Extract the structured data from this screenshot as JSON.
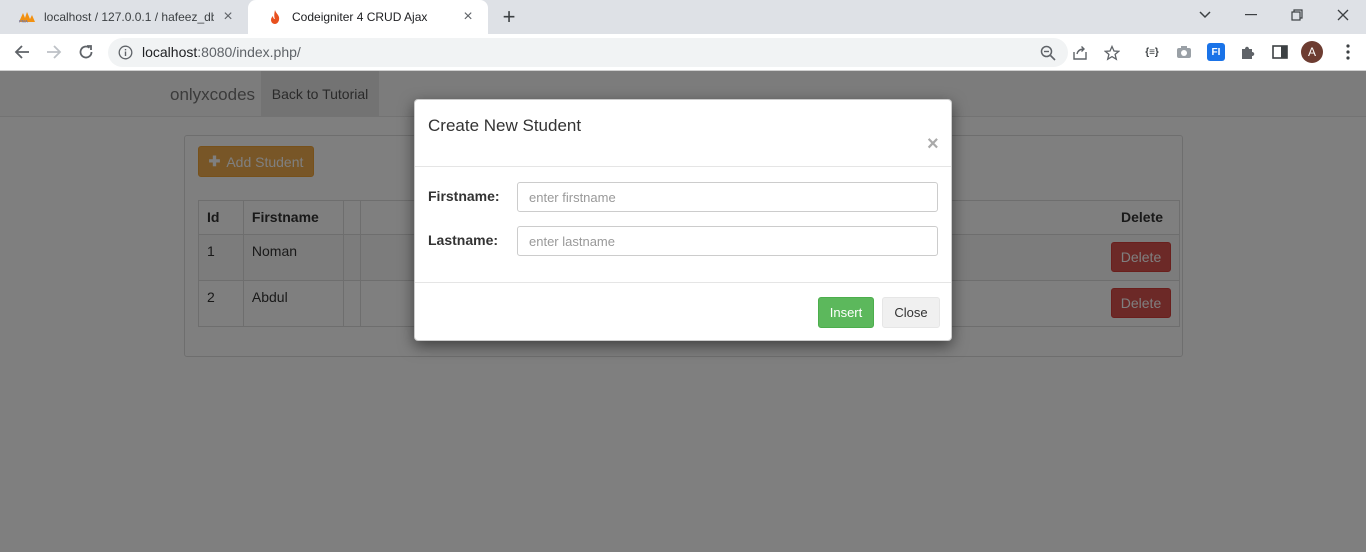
{
  "browser": {
    "tabs": [
      {
        "title": "localhost / 127.0.0.1 / hafeez_db / ",
        "active": false,
        "favicon": "phpmyadmin-icon"
      },
      {
        "title": "Codeigniter 4 CRUD Ajax",
        "active": true,
        "favicon": "codeigniter-flame-icon"
      }
    ],
    "url_host": "localhost",
    "url_rest": ":8080/index.php/",
    "profile_initial": "A",
    "extension_label": "{≡}",
    "extension_fi": "FI"
  },
  "page": {
    "brand": "onlyxcodes",
    "nav_link": "Back to Tutorial",
    "add_button": "Add Student",
    "table": {
      "headers": [
        "Id",
        "Firstname",
        "Delete"
      ],
      "rows": [
        {
          "id": "1",
          "firstname": "Noman",
          "action": "Delete"
        },
        {
          "id": "2",
          "firstname": "Abdul",
          "action": "Delete"
        }
      ]
    }
  },
  "modal": {
    "title": "Create New Student",
    "close_symbol": "×",
    "fields": [
      {
        "label": "Firstname:",
        "placeholder": "enter firstname",
        "value": ""
      },
      {
        "label": "Lastname:",
        "placeholder": "enter lastname",
        "value": ""
      }
    ],
    "insert_label": "Insert",
    "close_label": "Close"
  },
  "colors": {
    "warning": "#f0ad4e",
    "danger": "#d9534f",
    "success": "#5cb85c"
  }
}
